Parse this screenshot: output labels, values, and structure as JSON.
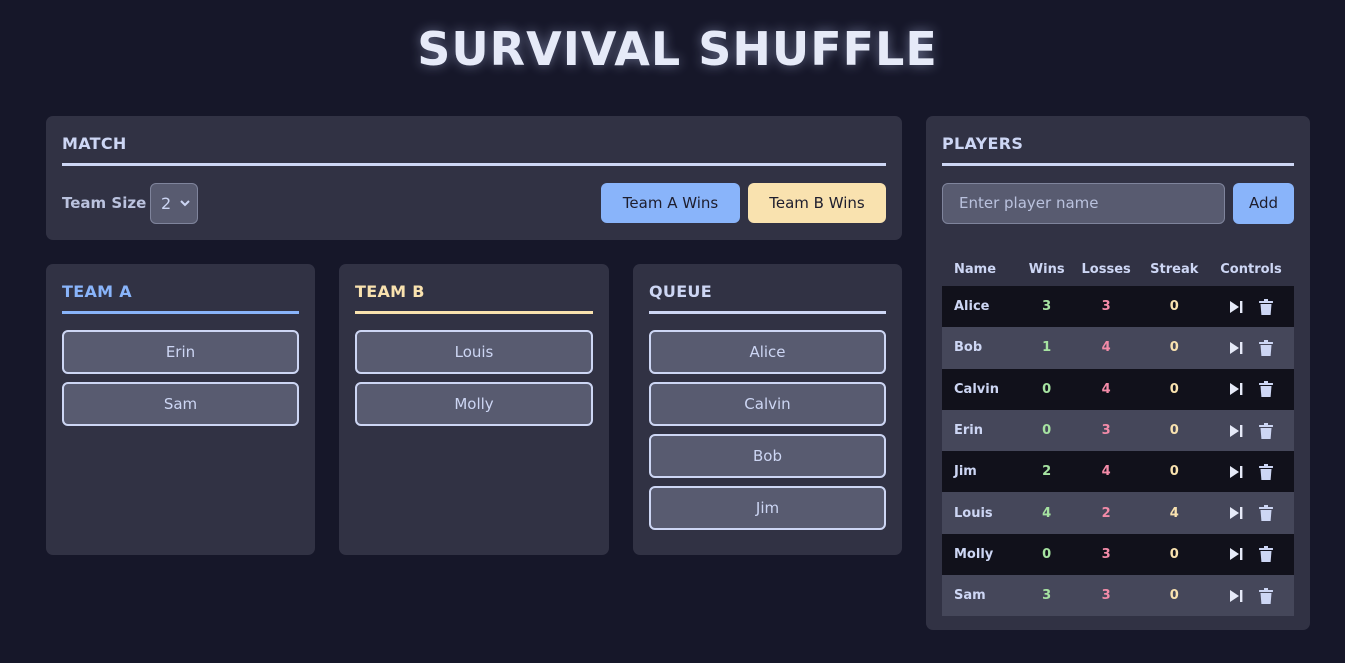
{
  "app": {
    "title": "SURVIVAL SHUFFLE"
  },
  "match": {
    "heading": "MATCH",
    "team_size_label": "Team Size",
    "team_size_value": "2",
    "team_a_wins_label": "Team A Wins",
    "team_b_wins_label": "Team B Wins"
  },
  "team_a": {
    "heading": "TEAM A",
    "players": [
      "Erin",
      "Sam"
    ]
  },
  "team_b": {
    "heading": "TEAM B",
    "players": [
      "Louis",
      "Molly"
    ]
  },
  "queue": {
    "heading": "QUEUE",
    "players": [
      "Alice",
      "Calvin",
      "Bob",
      "Jim"
    ]
  },
  "players": {
    "heading": "PLAYERS",
    "input_placeholder": "Enter player name",
    "add_label": "Add",
    "columns": [
      "Name",
      "Wins",
      "Losses",
      "Streak",
      "Controls"
    ],
    "rows": [
      {
        "name": "Alice",
        "wins": "3",
        "losses": "3",
        "streak": "0"
      },
      {
        "name": "Bob",
        "wins": "1",
        "losses": "4",
        "streak": "0"
      },
      {
        "name": "Calvin",
        "wins": "0",
        "losses": "4",
        "streak": "0"
      },
      {
        "name": "Erin",
        "wins": "0",
        "losses": "3",
        "streak": "0"
      },
      {
        "name": "Jim",
        "wins": "2",
        "losses": "4",
        "streak": "0"
      },
      {
        "name": "Louis",
        "wins": "4",
        "losses": "2",
        "streak": "4"
      },
      {
        "name": "Molly",
        "wins": "0",
        "losses": "3",
        "streak": "0"
      },
      {
        "name": "Sam",
        "wins": "3",
        "losses": "3",
        "streak": "0"
      }
    ],
    "control_icons": [
      "skip-next-icon",
      "trash-icon"
    ]
  },
  "colors": {
    "background": "#161729",
    "panel": "#313244",
    "team_a_accent": "#89b4fa",
    "team_b_accent": "#f9e2af",
    "wins": "#a6e3a1",
    "losses": "#f38ba8",
    "streak": "#f9e2af"
  }
}
